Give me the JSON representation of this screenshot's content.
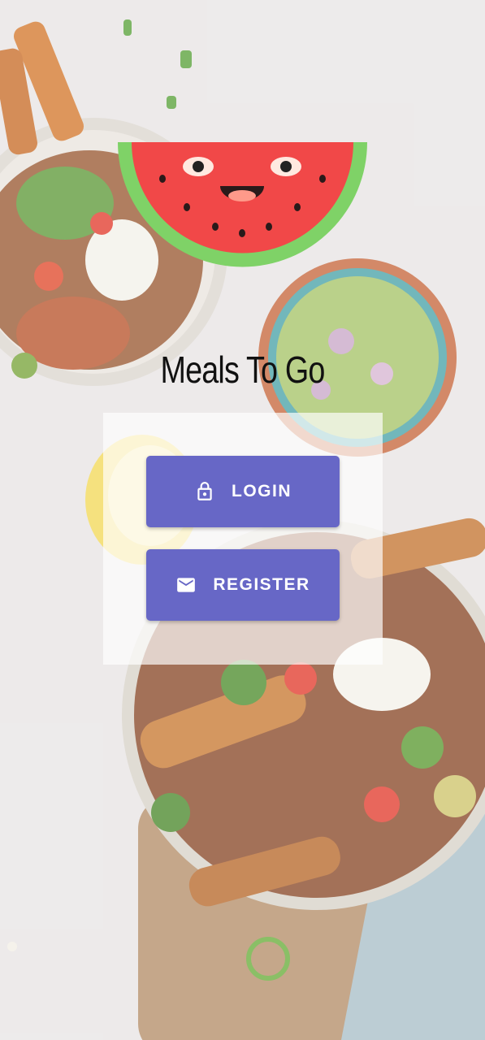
{
  "app": {
    "title": "Meals To Go"
  },
  "buttons": {
    "login_label": "LOGIN",
    "register_label": "REGISTER"
  },
  "icons": {
    "login": "lock-icon",
    "register": "mail-icon",
    "logo": "watermelon-icon"
  },
  "colors": {
    "button": "#6767c6",
    "watermelon_flesh": "#f14848",
    "watermelon_rind": "#7fd267"
  }
}
